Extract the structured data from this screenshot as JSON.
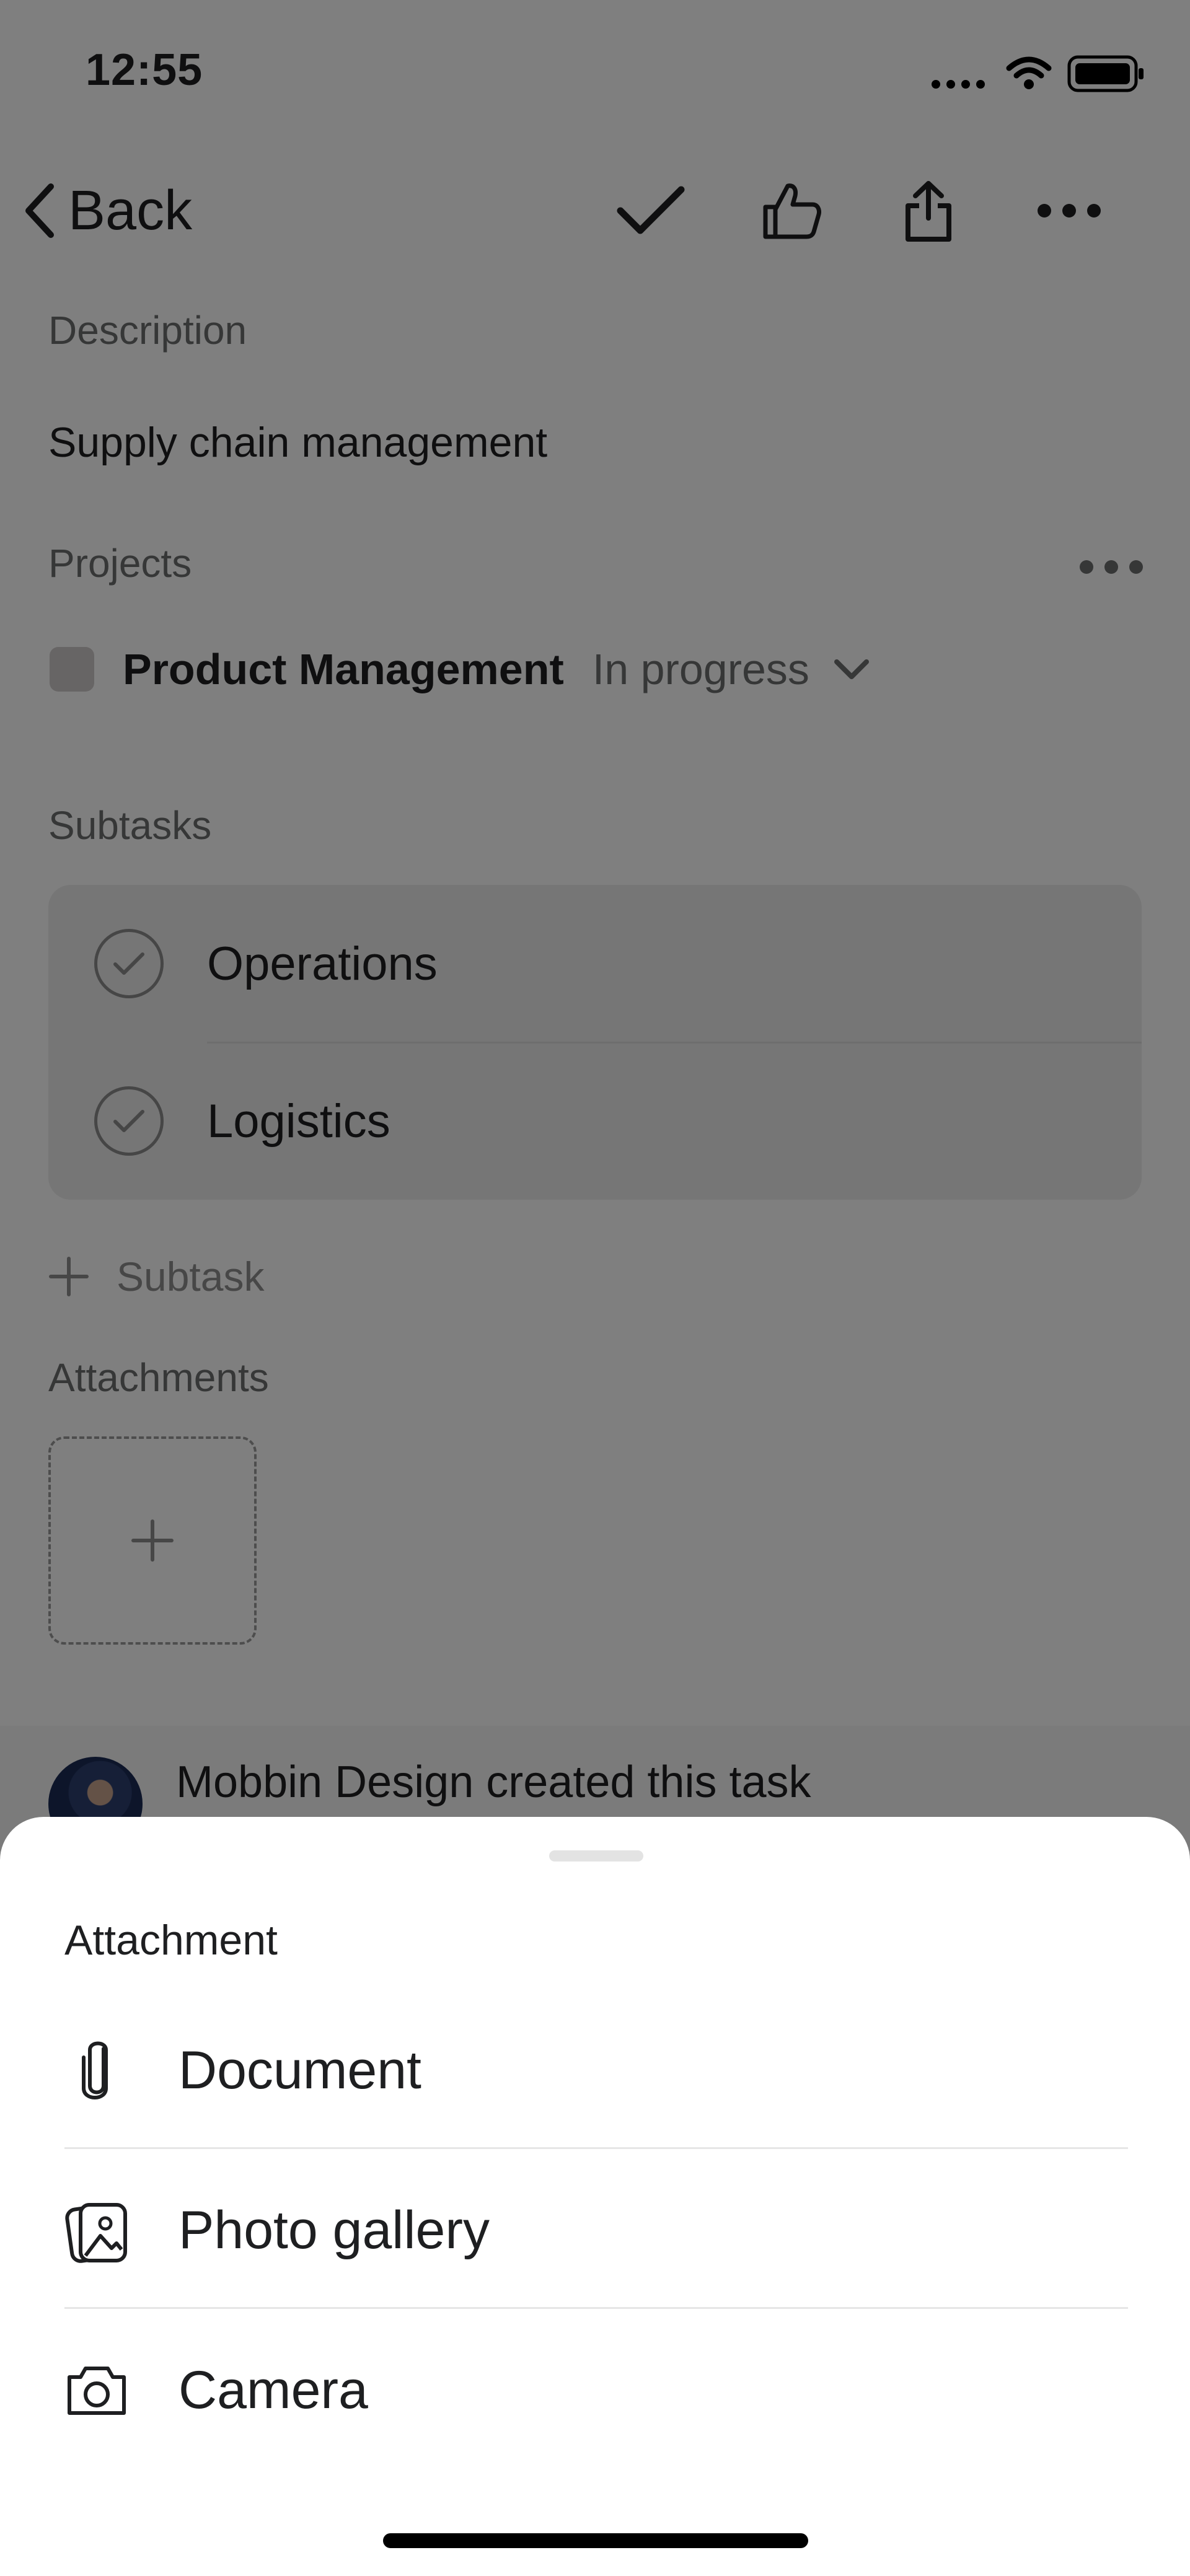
{
  "status_bar": {
    "time": "12:55"
  },
  "nav": {
    "back_label": "Back",
    "icons": [
      "checkmark-icon",
      "thumbs-up-icon",
      "share-icon",
      "more-icon"
    ]
  },
  "description": {
    "label": "Description",
    "value": "Supply chain management"
  },
  "projects": {
    "label": "Projects",
    "items": [
      {
        "name": "Product Management",
        "status": "In progress"
      }
    ]
  },
  "subtasks": {
    "label": "Subtasks",
    "items": [
      {
        "label": "Operations"
      },
      {
        "label": "Logistics"
      }
    ],
    "add_label": "Subtask"
  },
  "attachments": {
    "label": "Attachments"
  },
  "activity": {
    "text": "Mobbin Design created this task"
  },
  "sheet": {
    "title": "Attachment",
    "items": [
      {
        "label": "Document",
        "icon": "paperclip-icon"
      },
      {
        "label": "Photo gallery",
        "icon": "photo-gallery-icon"
      },
      {
        "label": "Camera",
        "icon": "camera-icon"
      }
    ]
  },
  "colors": {
    "overlay": "rgba(0,0,0,0.5)",
    "text": "#1e1f21",
    "muted": "#6d6e6f"
  }
}
